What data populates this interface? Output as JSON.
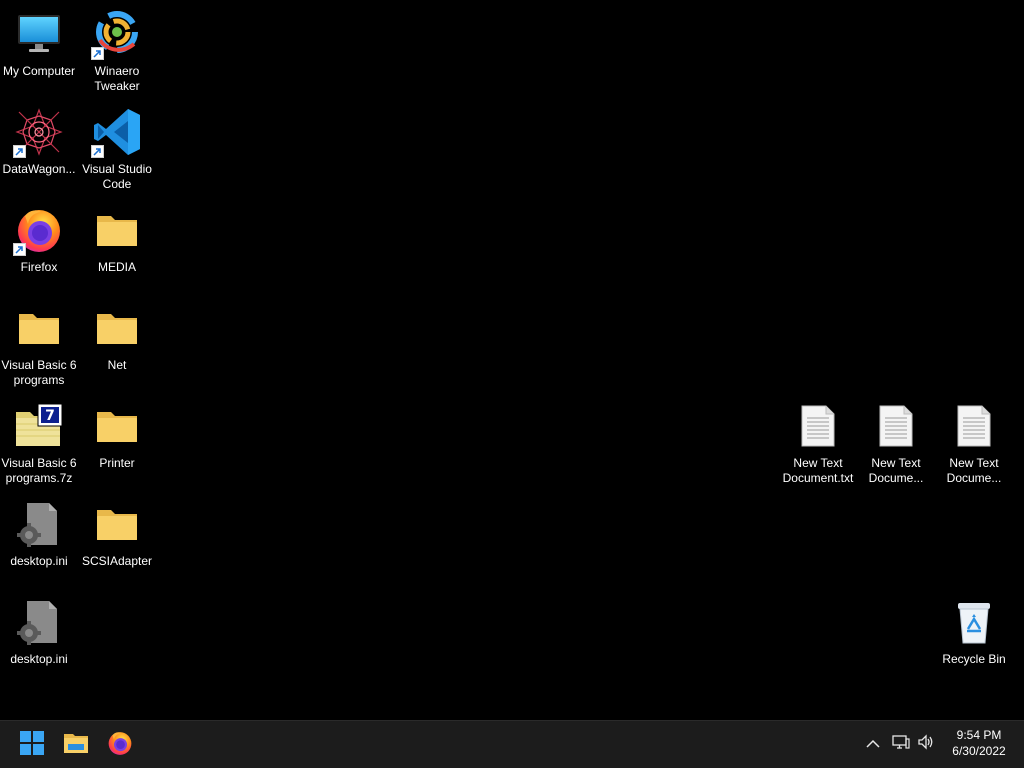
{
  "desktop": {
    "icons": {
      "my_computer": {
        "label": "My Computer"
      },
      "winaero": {
        "label": "Winaero Tweaker"
      },
      "datawagon": {
        "label": "DataWagon..."
      },
      "vscode": {
        "label": "Visual Studio Code"
      },
      "firefox": {
        "label": "Firefox"
      },
      "media": {
        "label": "MEDIA"
      },
      "vb6_programs": {
        "label": "Visual Basic 6 programs"
      },
      "net": {
        "label": "Net"
      },
      "vb6_7z": {
        "label": "Visual Basic 6 programs.7z"
      },
      "printer": {
        "label": "Printer"
      },
      "desktop_ini_1": {
        "label": "desktop.ini"
      },
      "scsi": {
        "label": "SCSIAdapter"
      },
      "desktop_ini_2": {
        "label": "desktop.ini"
      },
      "text_doc_1": {
        "label": "New Text Document.txt"
      },
      "text_doc_2": {
        "label": "New Text Docume..."
      },
      "text_doc_3": {
        "label": "New Text Docume..."
      },
      "recycle_bin": {
        "label": "Recycle Bin"
      }
    }
  },
  "taskbar": {
    "pinned": [
      {
        "name": "Start",
        "icon": "windows-logo-icon"
      },
      {
        "name": "File Explorer",
        "icon": "file-explorer-icon"
      },
      {
        "name": "Firefox",
        "icon": "firefox-icon"
      }
    ],
    "tray": {
      "icons": [
        "chevron-up-icon",
        "network-icon",
        "volume-icon"
      ]
    },
    "clock": {
      "time": "9:54 PM",
      "date": "6/30/2022"
    }
  },
  "colors": {
    "desktop_bg": "#000000",
    "taskbar_bg": "#1c1c1c",
    "folder": "#f8d067",
    "windows_blue": "#3aa6f4",
    "vscode_blue": "#1f8fe0"
  }
}
